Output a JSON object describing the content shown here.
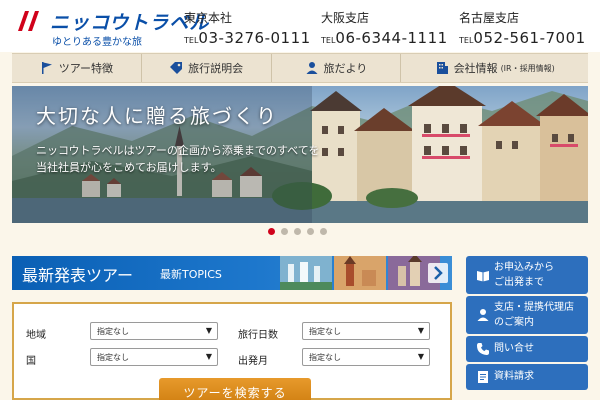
{
  "brand": {
    "name": "ニッコウトラベル",
    "tagline": "ゆとりある豊かな旅",
    "color": "#0a4fa8",
    "accent": "#d0021b"
  },
  "branches": [
    {
      "name": "東京本社",
      "tel_label": "TEL",
      "tel": "03-3276-0111"
    },
    {
      "name": "大阪支店",
      "tel_label": "TEL",
      "tel": "06-6344-1111"
    },
    {
      "name": "名古屋支店",
      "tel_label": "TEL",
      "tel": "052-561-7001"
    }
  ],
  "nav": [
    {
      "label": "ツアー特徴",
      "icon": "flag-icon"
    },
    {
      "label": "旅行説明会",
      "icon": "tag-icon"
    },
    {
      "label": "旅だより",
      "icon": "person-icon"
    },
    {
      "label": "会社情報",
      "sub": "(IR・採用情報)",
      "icon": "building-icon"
    }
  ],
  "hero": {
    "headline": "大切な人に贈る旅づくり",
    "body": "ニッコウトラベルはツアーの企画から添乗までのすべてを当社社員が心をこめてお届けします。",
    "slide_count": 5,
    "active_slide": 1
  },
  "topics": {
    "title": "最新発表ツアー",
    "subtitle": "最新TOPICS"
  },
  "search": {
    "fields": [
      {
        "label": "地域",
        "value": "指定なし"
      },
      {
        "label": "旅行日数",
        "value": "指定なし"
      },
      {
        "label": "国",
        "value": "指定なし"
      },
      {
        "label": "出発月",
        "value": "指定なし"
      }
    ],
    "button": "ツアーを検索する"
  },
  "side_menu": [
    {
      "lines": [
        "お申込みから",
        "ご出発まで"
      ],
      "icon": "book-icon"
    },
    {
      "lines": [
        "支店・提携代理店",
        "のご案内"
      ],
      "icon": "person-icon"
    },
    {
      "lines": [
        "問い合せ"
      ],
      "icon": "phone-icon"
    },
    {
      "lines": [
        "資料請求"
      ],
      "icon": "document-icon"
    }
  ]
}
